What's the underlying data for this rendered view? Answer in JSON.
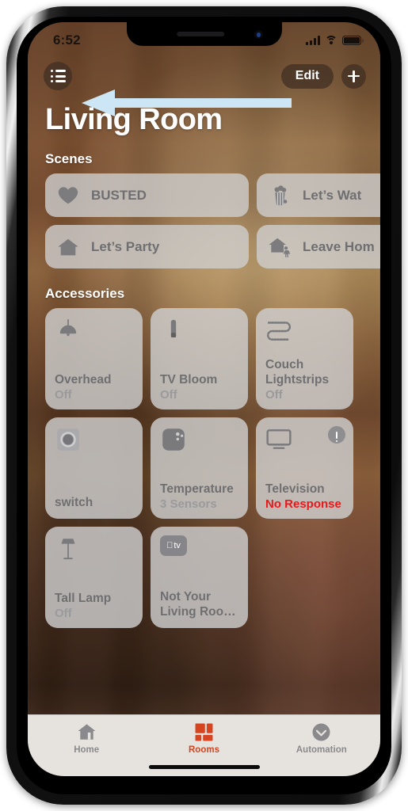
{
  "status_bar": {
    "time": "6:52",
    "signal_icon": "cellular-signal-icon",
    "wifi_icon": "wifi-icon",
    "battery_icon": "battery-icon"
  },
  "nav": {
    "list_button_icon": "list-menu-icon",
    "edit_label": "Edit",
    "add_label": "+"
  },
  "annotation": {
    "type": "left-pointing-arrow",
    "color": "#cce6f5",
    "points_to": "list-menu-button"
  },
  "header": {
    "room_title": "Living Room"
  },
  "scenes": {
    "section_label": "Scenes",
    "items": [
      {
        "label": "BUSTED",
        "icon": "heart-icon"
      },
      {
        "label": "Let’s Wat",
        "icon": "popcorn-icon"
      },
      {
        "label": "Let’s Party",
        "icon": "house-icon"
      },
      {
        "label": "Leave Hom",
        "icon": "house-person-icon"
      }
    ]
  },
  "accessories": {
    "section_label": "Accessories",
    "items": [
      {
        "name": "Overhead",
        "state": "Off",
        "icon": "pendant-lamp-icon",
        "state_error": false,
        "badge": "none"
      },
      {
        "name": "TV Bloom",
        "state": "Off",
        "icon": "light-bar-icon",
        "state_error": false,
        "badge": "none"
      },
      {
        "name": "Couch Lightstrips",
        "state": "Off",
        "icon": "light-strip-icon",
        "state_error": false,
        "badge": "none"
      },
      {
        "name": "switch",
        "state": "",
        "icon": "switch-icon",
        "state_error": false,
        "badge": "none"
      },
      {
        "name": "Temperature",
        "state": "3 Sensors",
        "icon": "sensor-icon",
        "state_error": false,
        "badge": "none"
      },
      {
        "name": "Television",
        "state": "No Response",
        "icon": "television-icon",
        "state_error": true,
        "badge": "warning-badge"
      },
      {
        "name": "Tall Lamp",
        "state": "Off",
        "icon": "floor-lamp-icon",
        "state_error": false,
        "badge": "none"
      },
      {
        "name": "Not Your Living Roo…",
        "state": "",
        "icon": "apple-tv-icon",
        "state_error": false,
        "badge": "none"
      }
    ]
  },
  "tab_bar": {
    "active_color": "#d64520",
    "inactive_color": "#8a8a8d",
    "tabs": [
      {
        "label": "Home",
        "icon": "home-icon",
        "active": false
      },
      {
        "label": "Rooms",
        "icon": "rooms-icon",
        "active": true
      },
      {
        "label": "Automation",
        "icon": "automation-icon",
        "active": false
      }
    ]
  }
}
